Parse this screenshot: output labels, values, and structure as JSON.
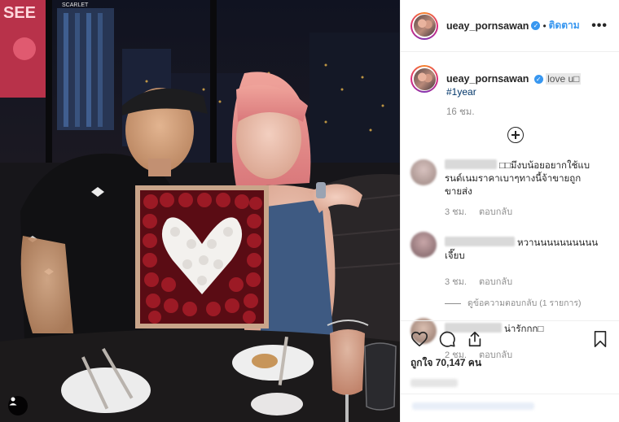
{
  "post": {
    "username": "ueay_pornsawan",
    "follow_label": "ติดตาม",
    "header_separator": "•",
    "more_label": "•••",
    "verified_mark": "✓"
  },
  "photo": {
    "signs": [
      "SEE",
      "SCARLET"
    ]
  },
  "caption": {
    "username": "ueay_pornsawan",
    "text": "love u□",
    "hashtag": "#1year",
    "time": "16 ชม."
  },
  "comments": [
    {
      "text": "□□มึงบน้อยอยากใช้แบ รนด์เนมราคาเบาๆทางนี้จ้าขายถูกขายส่ง",
      "time": "3 ชม.",
      "reply_label": "ตอบกลับ"
    },
    {
      "text": "หวานนนนนนนนนนเจี๊ยบ",
      "time": "3 ชม.",
      "reply_label": "ตอบกลับ",
      "view_replies": "ดูข้อความตอบกลับ (1 รายการ)"
    },
    {
      "text": "น่ารักกก□",
      "time": "2 ชม.",
      "reply_label": "ตอบกลับ"
    }
  ],
  "actions": {
    "icons": [
      "heart-icon",
      "comment-icon",
      "share-icon",
      "bookmark-icon"
    ],
    "likes": "ถูกใจ 70,147 คน"
  },
  "colors": {
    "accent": "#3897f0",
    "hashtag": "#003569",
    "muted": "#8e8e8e"
  }
}
